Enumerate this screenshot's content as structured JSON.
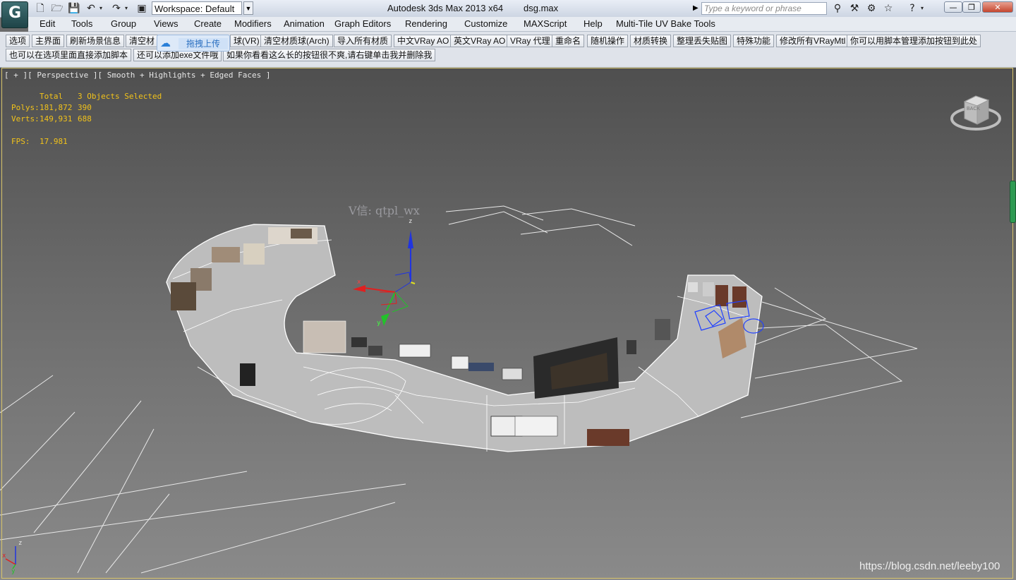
{
  "titlebar": {
    "logo_glyph": "G",
    "workspace_value": "Workspace: Default",
    "app_title": "Autodesk 3ds Max  2013 x64",
    "file_name": "dsg.max",
    "search_placeholder": "Type a keyword or phrase",
    "icons": [
      "new-file-icon",
      "open-folder-icon",
      "save-icon",
      "undo-icon",
      "redo-icon",
      "project-folder-icon",
      "binoculars-icon",
      "communication-icon",
      "star-icon",
      "help-icon"
    ],
    "window_buttons": {
      "minimize": "—",
      "restore": "❐",
      "close": "✕"
    }
  },
  "menubar": {
    "items": [
      "Edit",
      "Tools",
      "Group",
      "Views",
      "Create",
      "Modifiers",
      "Animation",
      "Graph Editors",
      "Rendering",
      "Customize",
      "MAXScript",
      "Help",
      "Multi-Tile UV Bake Tools"
    ]
  },
  "toolbar_row1": [
    "选项",
    "主界面",
    "刷新场景信息",
    "清空材",
    "球(VR)",
    "清空材质球(Arch)",
    "导入所有材质",
    "中文VRay AO",
    "英文VRay AO",
    "VRay 代理",
    "重命名",
    "随机操作",
    "材质转换",
    "整理丢失贴图",
    "特殊功能",
    "修改所有VRayMtl",
    "你可以用脚本管理添加按钮到此处"
  ],
  "toolbar_row2": [
    "也可以在选项里面直接添加脚本",
    "还可以添加exe文件哦",
    "如果你看看这么长的按钮很不爽,请右键单击我并删除我"
  ],
  "upload_popup": {
    "label": "拖拽上传",
    "icon": "cloud-upload-icon"
  },
  "viewport": {
    "label": "[ + ][ Perspective ][ Smooth + Highlights + Edged Faces ]",
    "stats": {
      "header_total": "Total",
      "header_selected": "3 Objects Selected",
      "polys_label": "Polys:",
      "polys_total": "181,872",
      "polys_selected": "390",
      "verts_label": "Verts:",
      "verts_total": "149,931",
      "verts_selected": "688",
      "fps_label": "FPS:",
      "fps_value": "17.981"
    },
    "watermark": "V信: qtpl_wx",
    "url_watermark": "https://blog.csdn.net/leeby100",
    "viewcube_label": "BACK",
    "gizmo_axes": {
      "x": "x",
      "y": "y",
      "z": "z"
    }
  },
  "colors": {
    "stats_yellow": "#f1c21a",
    "axis_x": "#e02020",
    "axis_y": "#22c22a",
    "axis_z": "#2034e0",
    "selected_blue": "#2040ff"
  }
}
